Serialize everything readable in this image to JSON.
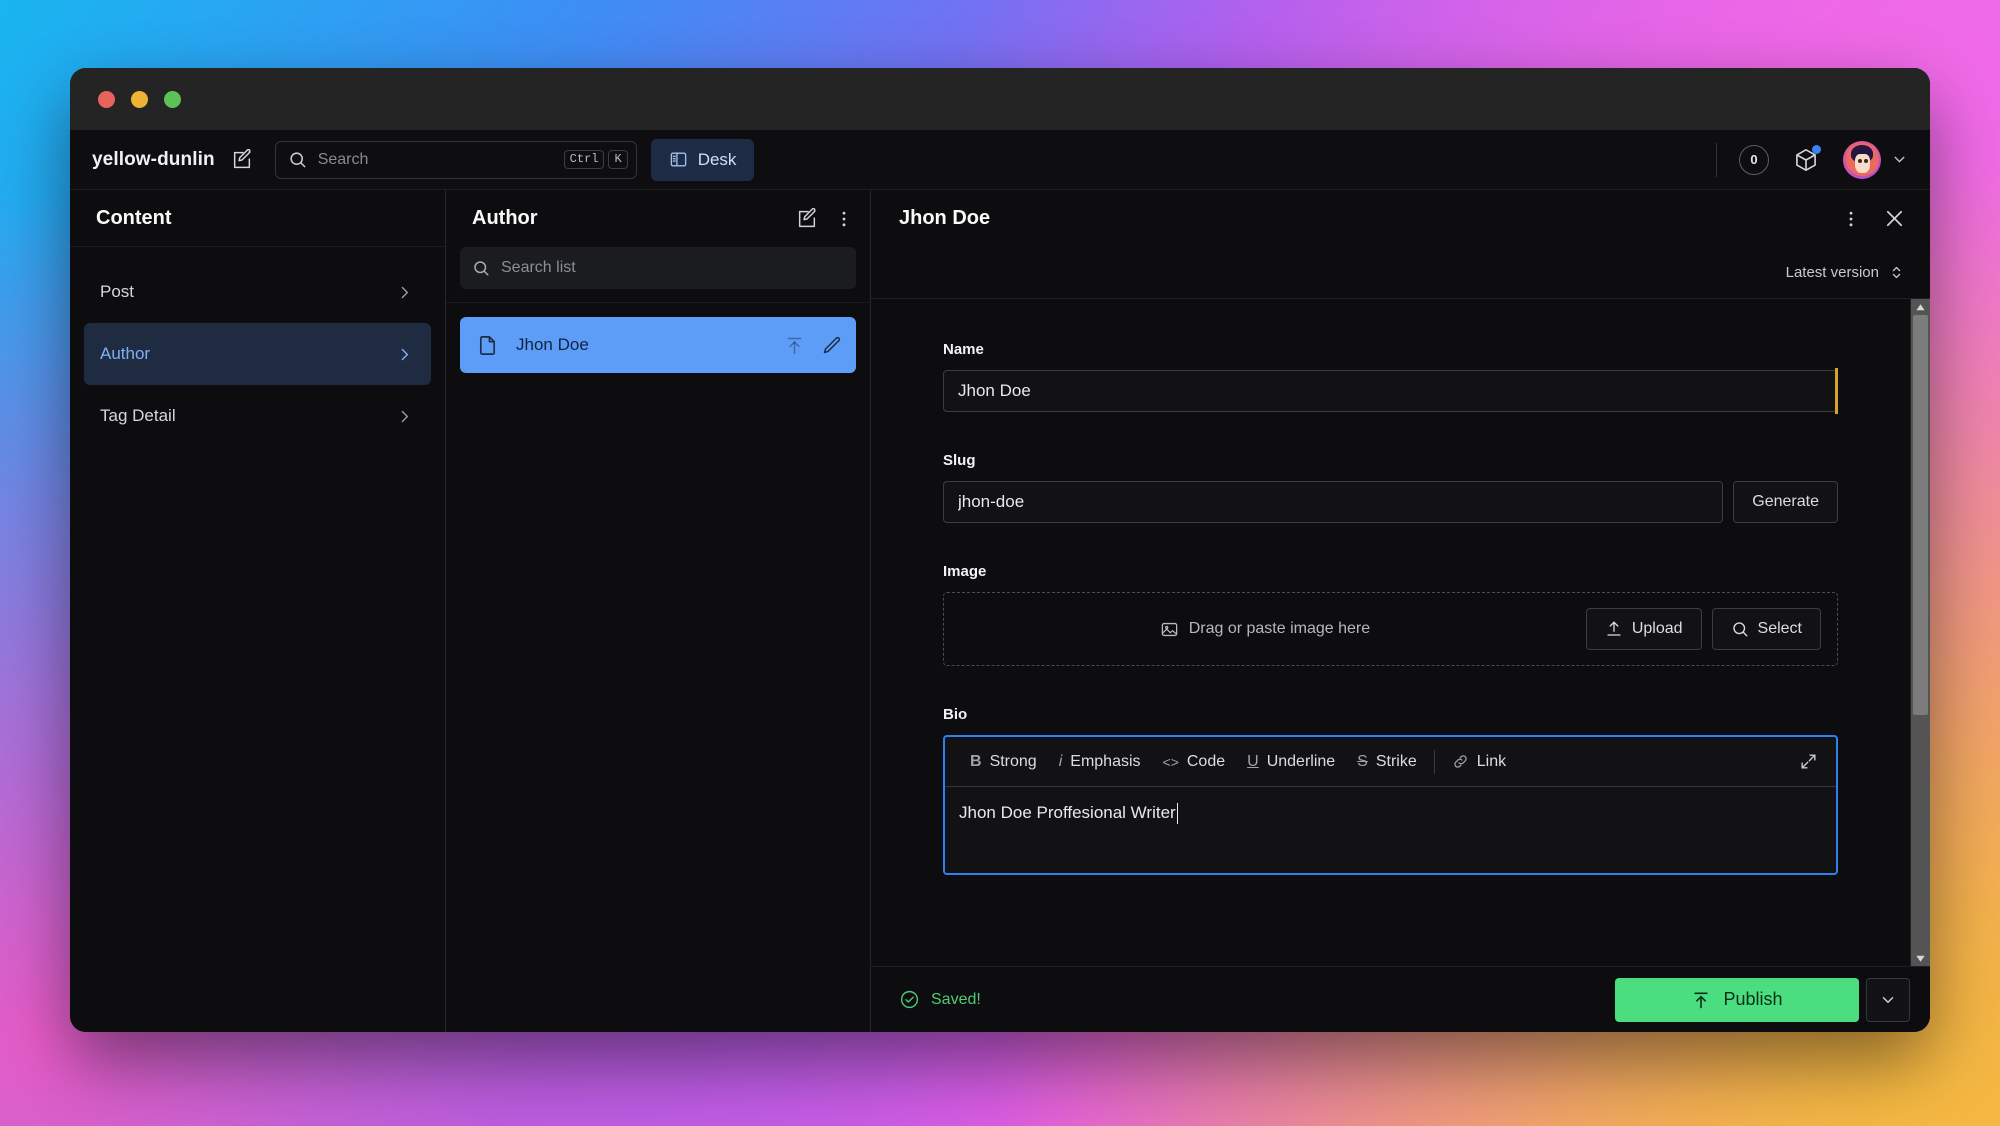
{
  "window": {
    "traffic_lights": [
      "close",
      "minimize",
      "maximize"
    ]
  },
  "header": {
    "brand": "yellow-dunlin",
    "brand_edit_icon": "edit-square-icon",
    "search": {
      "placeholder": "Search",
      "value": "",
      "icon": "search-icon",
      "shortcut_keys": [
        "Ctrl",
        "K"
      ]
    },
    "desk_tab": {
      "label": "Desk",
      "icon": "panels-layout-icon",
      "active": true
    },
    "notifications_badge": "0",
    "cube_icon": "package-cube-icon",
    "cube_has_update_dot": true,
    "avatar": {
      "name": "avatar",
      "chevron": "chevron-down-icon"
    }
  },
  "content_pane": {
    "title": "Content",
    "items": [
      {
        "label": "Post",
        "active": false,
        "chevron": "chevron-right-icon"
      },
      {
        "label": "Author",
        "active": true,
        "chevron": "chevron-right-icon"
      },
      {
        "label": "Tag Detail",
        "active": false,
        "chevron": "chevron-right-icon"
      }
    ]
  },
  "list_pane": {
    "title": "Author",
    "create_icon": "edit-square-icon",
    "menu_icon": "more-vertical-icon",
    "search": {
      "placeholder": "Search list",
      "value": "",
      "icon": "search-icon"
    },
    "documents": [
      {
        "label": "Jhon Doe",
        "selected": true,
        "doc_icon": "document-icon",
        "publish_icon": "publish-arrow-icon",
        "edit_icon": "pencil-icon"
      }
    ]
  },
  "document_pane": {
    "title": "Jhon Doe",
    "menu_icon": "more-vertical-icon",
    "close_icon": "close-icon",
    "version": {
      "label": "Latest version",
      "icon": "chevron-up-down-icon"
    },
    "fields": {
      "name": {
        "label": "Name",
        "value": "Jhon Doe",
        "focused": true
      },
      "slug": {
        "label": "Slug",
        "value": "jhon-doe",
        "generate_label": "Generate"
      },
      "image": {
        "label": "Image",
        "drop_hint": "Drag or paste image here",
        "drop_icon": "image-icon",
        "upload_label": "Upload",
        "upload_icon": "upload-icon",
        "select_label": "Select",
        "select_icon": "search-icon"
      },
      "bio": {
        "label": "Bio",
        "value": "Jhon Doe Proffesional Writer",
        "toolbar": [
          {
            "glyph": "B",
            "label": "Strong",
            "icon": "bold-icon"
          },
          {
            "glyph": "i",
            "label": "Emphasis",
            "icon": "italic-icon"
          },
          {
            "glyph": "<>",
            "label": "Code",
            "icon": "code-icon"
          },
          {
            "glyph": "U",
            "label": "Underline",
            "icon": "underline-icon"
          },
          {
            "glyph": "S",
            "label": "Strike",
            "icon": "strikethrough-icon"
          },
          {
            "glyph": "⚭",
            "label": "Link",
            "icon": "link-icon"
          }
        ],
        "expand_icon": "expand-icon"
      }
    },
    "footer": {
      "status_label": "Saved!",
      "status_icon": "check-circle-icon",
      "publish_label": "Publish",
      "publish_icon": "publish-arrow-icon",
      "publish_chevron": "chevron-down-icon"
    }
  },
  "colors": {
    "accent_blue": "#5d9df8",
    "publish_green": "#4ade80",
    "saved_green": "#4ecb7a",
    "focus_blue": "#2f7ff0",
    "warning_amber": "#d6a32a",
    "panel_bg": "#0d0d0f",
    "titlebar_bg": "#242424"
  }
}
